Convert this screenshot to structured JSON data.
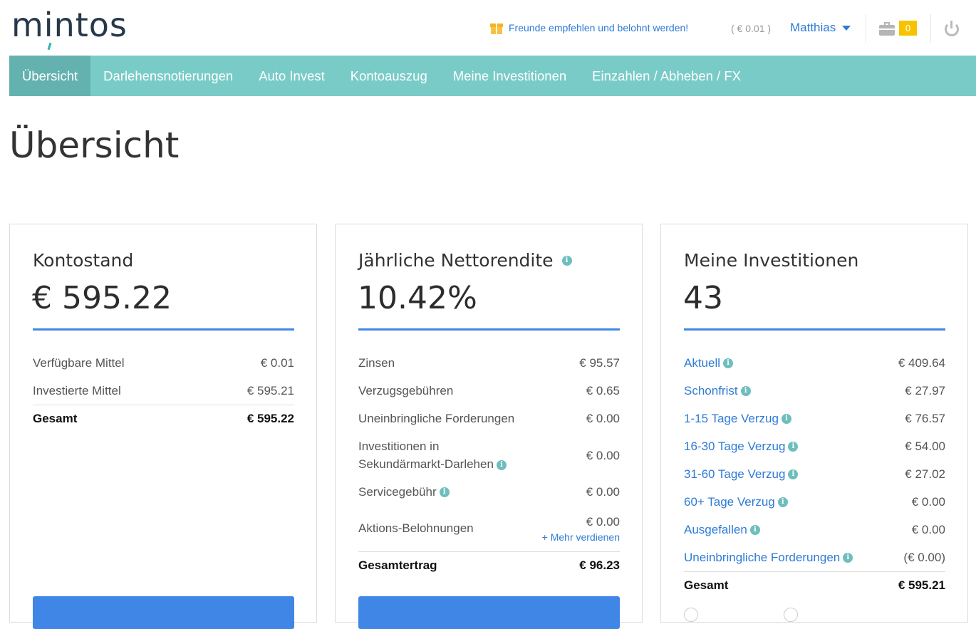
{
  "header": {
    "logo": "mintos",
    "promo": "Freunde empfehlen und belohnt werden!",
    "balance": "( € 0.01 )",
    "user": "Matthias",
    "badge_count": "0"
  },
  "nav": {
    "items": [
      "Übersicht",
      "Darlehensnotierungen",
      "Auto Invest",
      "Kontoauszug",
      "Meine Investitionen",
      "Einzahlen / Abheben / FX"
    ],
    "active": "Übersicht"
  },
  "page_title": "Übersicht",
  "kontostand": {
    "title": "Kontostand",
    "value": "€ 595.22",
    "rows": [
      {
        "label": "Verfügbare Mittel",
        "value": "€ 0.01"
      },
      {
        "label": "Investierte Mittel",
        "value": "€ 595.21"
      }
    ],
    "total": {
      "label": "Gesamt",
      "value": "€ 595.22"
    }
  },
  "rendite": {
    "title": "Jährliche Nettorendite",
    "value": "10.42%",
    "rows": [
      {
        "label": "Zinsen",
        "value": "€ 95.57"
      },
      {
        "label": "Verzugsgebühren",
        "value": "€ 0.65"
      },
      {
        "label": "Uneinbringliche Forderungen",
        "value": "€ 0.00"
      },
      {
        "label_line1": "Investitionen in",
        "label_line2": "Sekundärmarkt-Darlehen",
        "value": "€ 0.00"
      },
      {
        "label": "Servicegebühr",
        "value": "€ 0.00"
      },
      {
        "label": "Aktions-Belohnungen",
        "value": "€ 0.00",
        "link": "+ Mehr verdienen"
      }
    ],
    "total": {
      "label": "Gesamtertrag",
      "value": "€ 96.23"
    }
  },
  "investitionen": {
    "title": "Meine Investitionen",
    "value": "43",
    "rows": [
      {
        "label": "Aktuell",
        "value": "€ 409.64"
      },
      {
        "label": "Schonfrist",
        "value": "€ 27.97"
      },
      {
        "label": "1-15 Tage Verzug",
        "value": "€ 76.57"
      },
      {
        "label": "16-30 Tage Verzug",
        "value": "€ 54.00"
      },
      {
        "label": "31-60 Tage Verzug",
        "value": "€ 27.02"
      },
      {
        "label": "60+ Tage Verzug",
        "value": "€ 0.00"
      },
      {
        "label": "Ausgefallen",
        "value": "€ 0.00"
      },
      {
        "label": "Uneinbringliche Forderungen",
        "value": "(€ 0.00)"
      }
    ],
    "total": {
      "label": "Gesamt",
      "value": "€ 595.21"
    }
  },
  "colors": {
    "accent": "#3f86e6",
    "nav": "#79cbc8",
    "nav_active": "#64b2b0",
    "badge": "#f7c300"
  }
}
